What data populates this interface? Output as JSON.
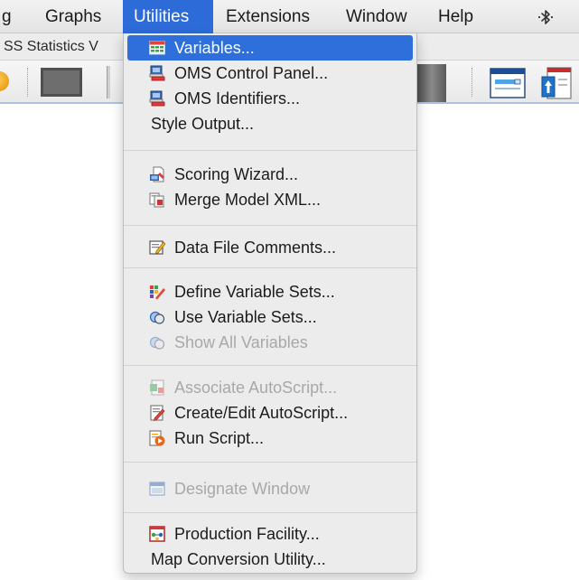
{
  "menubar": {
    "items": [
      {
        "label": "g"
      },
      {
        "label": "Graphs"
      },
      {
        "label": "Utilities"
      },
      {
        "label": "Extensions"
      },
      {
        "label": "Window"
      },
      {
        "label": "Help"
      }
    ],
    "active": "Utilities",
    "status_icon": "bluetooth-icon"
  },
  "window": {
    "title": "SS Statistics V"
  },
  "utilities_menu": {
    "items": [
      {
        "label": "Variables...",
        "icon": "variables-grid-icon",
        "enabled": true,
        "highlighted": true
      },
      {
        "label": "OMS Control Panel...",
        "icon": "oms-control-panel-icon",
        "enabled": true
      },
      {
        "label": "OMS Identifiers...",
        "icon": "oms-identifiers-icon",
        "enabled": true
      },
      {
        "label": "Style Output...",
        "icon": null,
        "enabled": true
      },
      {
        "label": "Scoring Wizard...",
        "icon": "scoring-wizard-icon",
        "enabled": true
      },
      {
        "label": "Merge Model XML...",
        "icon": "merge-model-xml-icon",
        "enabled": true
      },
      {
        "label": "Data File Comments...",
        "icon": "data-file-comments-icon",
        "enabled": true
      },
      {
        "label": "Define Variable Sets...",
        "icon": "define-variable-sets-icon",
        "enabled": true
      },
      {
        "label": "Use Variable Sets...",
        "icon": "use-variable-sets-icon",
        "enabled": true
      },
      {
        "label": "Show All Variables",
        "icon": "show-all-variables-icon",
        "enabled": false
      },
      {
        "label": "Associate AutoScript...",
        "icon": "associate-autoscript-icon",
        "enabled": false
      },
      {
        "label": "Create/Edit AutoScript...",
        "icon": "create-edit-autoscript-icon",
        "enabled": true
      },
      {
        "label": "Run Script...",
        "icon": "run-script-icon",
        "enabled": true
      },
      {
        "label": "Designate Window",
        "icon": "designate-window-icon",
        "enabled": false
      },
      {
        "label": "Production Facility...",
        "icon": "production-facility-icon",
        "enabled": true
      },
      {
        "label": "Map Conversion Utility...",
        "icon": null,
        "enabled": true
      }
    ]
  },
  "colors": {
    "highlight": "#2e6fdc",
    "menu_bg": "#ececec",
    "disabled_text": "#a8a8a8"
  }
}
